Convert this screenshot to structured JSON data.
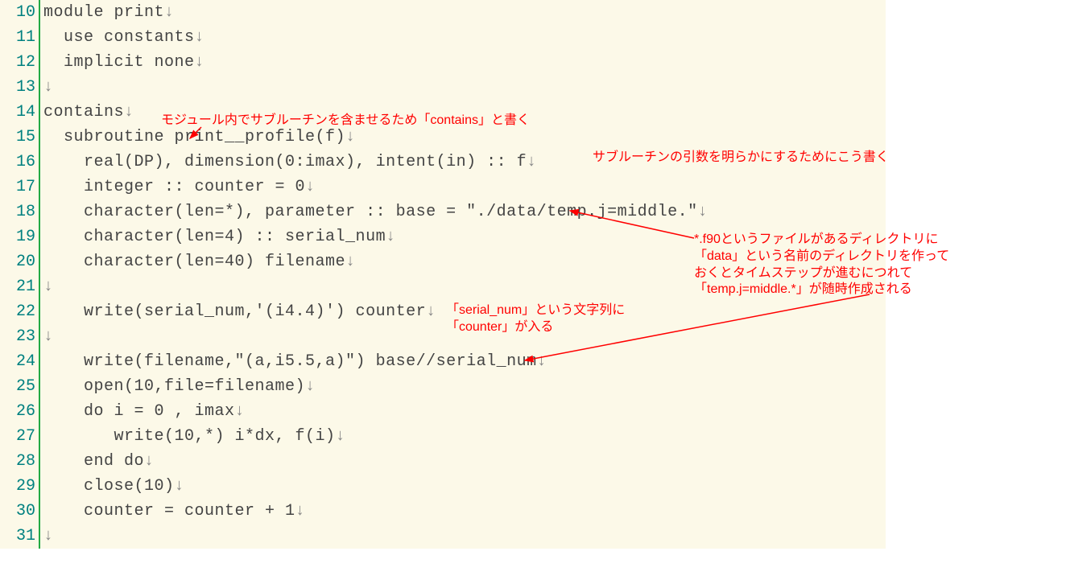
{
  "code_lines": [
    {
      "num": 10,
      "text": "module print",
      "indent": 0
    },
    {
      "num": 11,
      "text": "  use constants",
      "indent": 0
    },
    {
      "num": 12,
      "text": "  implicit none",
      "indent": 0
    },
    {
      "num": 13,
      "text": "",
      "indent": 0
    },
    {
      "num": 14,
      "text": "contains",
      "indent": 0
    },
    {
      "num": 15,
      "text": "  subroutine print__profile(f)",
      "indent": 0
    },
    {
      "num": 16,
      "text": "    real(DP), dimension(0:imax), intent(in) :: f",
      "indent": 0
    },
    {
      "num": 17,
      "text": "    integer :: counter = 0",
      "indent": 0
    },
    {
      "num": 18,
      "text": "    character(len=*), parameter :: base = \"./data/temp.j=middle.\"",
      "indent": 0
    },
    {
      "num": 19,
      "text": "    character(len=4) :: serial_num",
      "indent": 0
    },
    {
      "num": 20,
      "text": "    character(len=40) filename",
      "indent": 0
    },
    {
      "num": 21,
      "text": "",
      "indent": 0
    },
    {
      "num": 22,
      "text": "    write(serial_num,'(i4.4)') counter",
      "indent": 0
    },
    {
      "num": 23,
      "text": "",
      "indent": 0
    },
    {
      "num": 24,
      "text": "    write(filename,\"(a,i5.5,a)\") base//serial_num",
      "indent": 0
    },
    {
      "num": 25,
      "text": "    open(10,file=filename)",
      "indent": 0
    },
    {
      "num": 26,
      "text": "    do i = 0 , imax",
      "indent": 0
    },
    {
      "num": 27,
      "text": "       write(10,*) i*dx, f(i)",
      "indent": 0
    },
    {
      "num": 28,
      "text": "    end do",
      "indent": 0
    },
    {
      "num": 29,
      "text": "    close(10)",
      "indent": 0
    },
    {
      "num": 30,
      "text": "    counter = counter + 1",
      "indent": 0
    },
    {
      "num": 31,
      "text": "",
      "indent": 0
    }
  ],
  "annotations": {
    "a1": "モジュール内でサブルーチンを含ませるため「contains」と書く",
    "a2": "サブルーチンの引数を明らかにするためにこう書く",
    "a3_line1": "「serial_num」という文字列に",
    "a3_line2": "「counter」が入る",
    "a4_line1": "*.f90というファイルがあるディレクトリに",
    "a4_line2": "「data」という名前のディレクトリを作って",
    "a4_line3": "おくとタイムステップが進むにつれて",
    "a4_line4": "「temp.j=middle.*」が随時作成される"
  },
  "eol_marker": "↓"
}
